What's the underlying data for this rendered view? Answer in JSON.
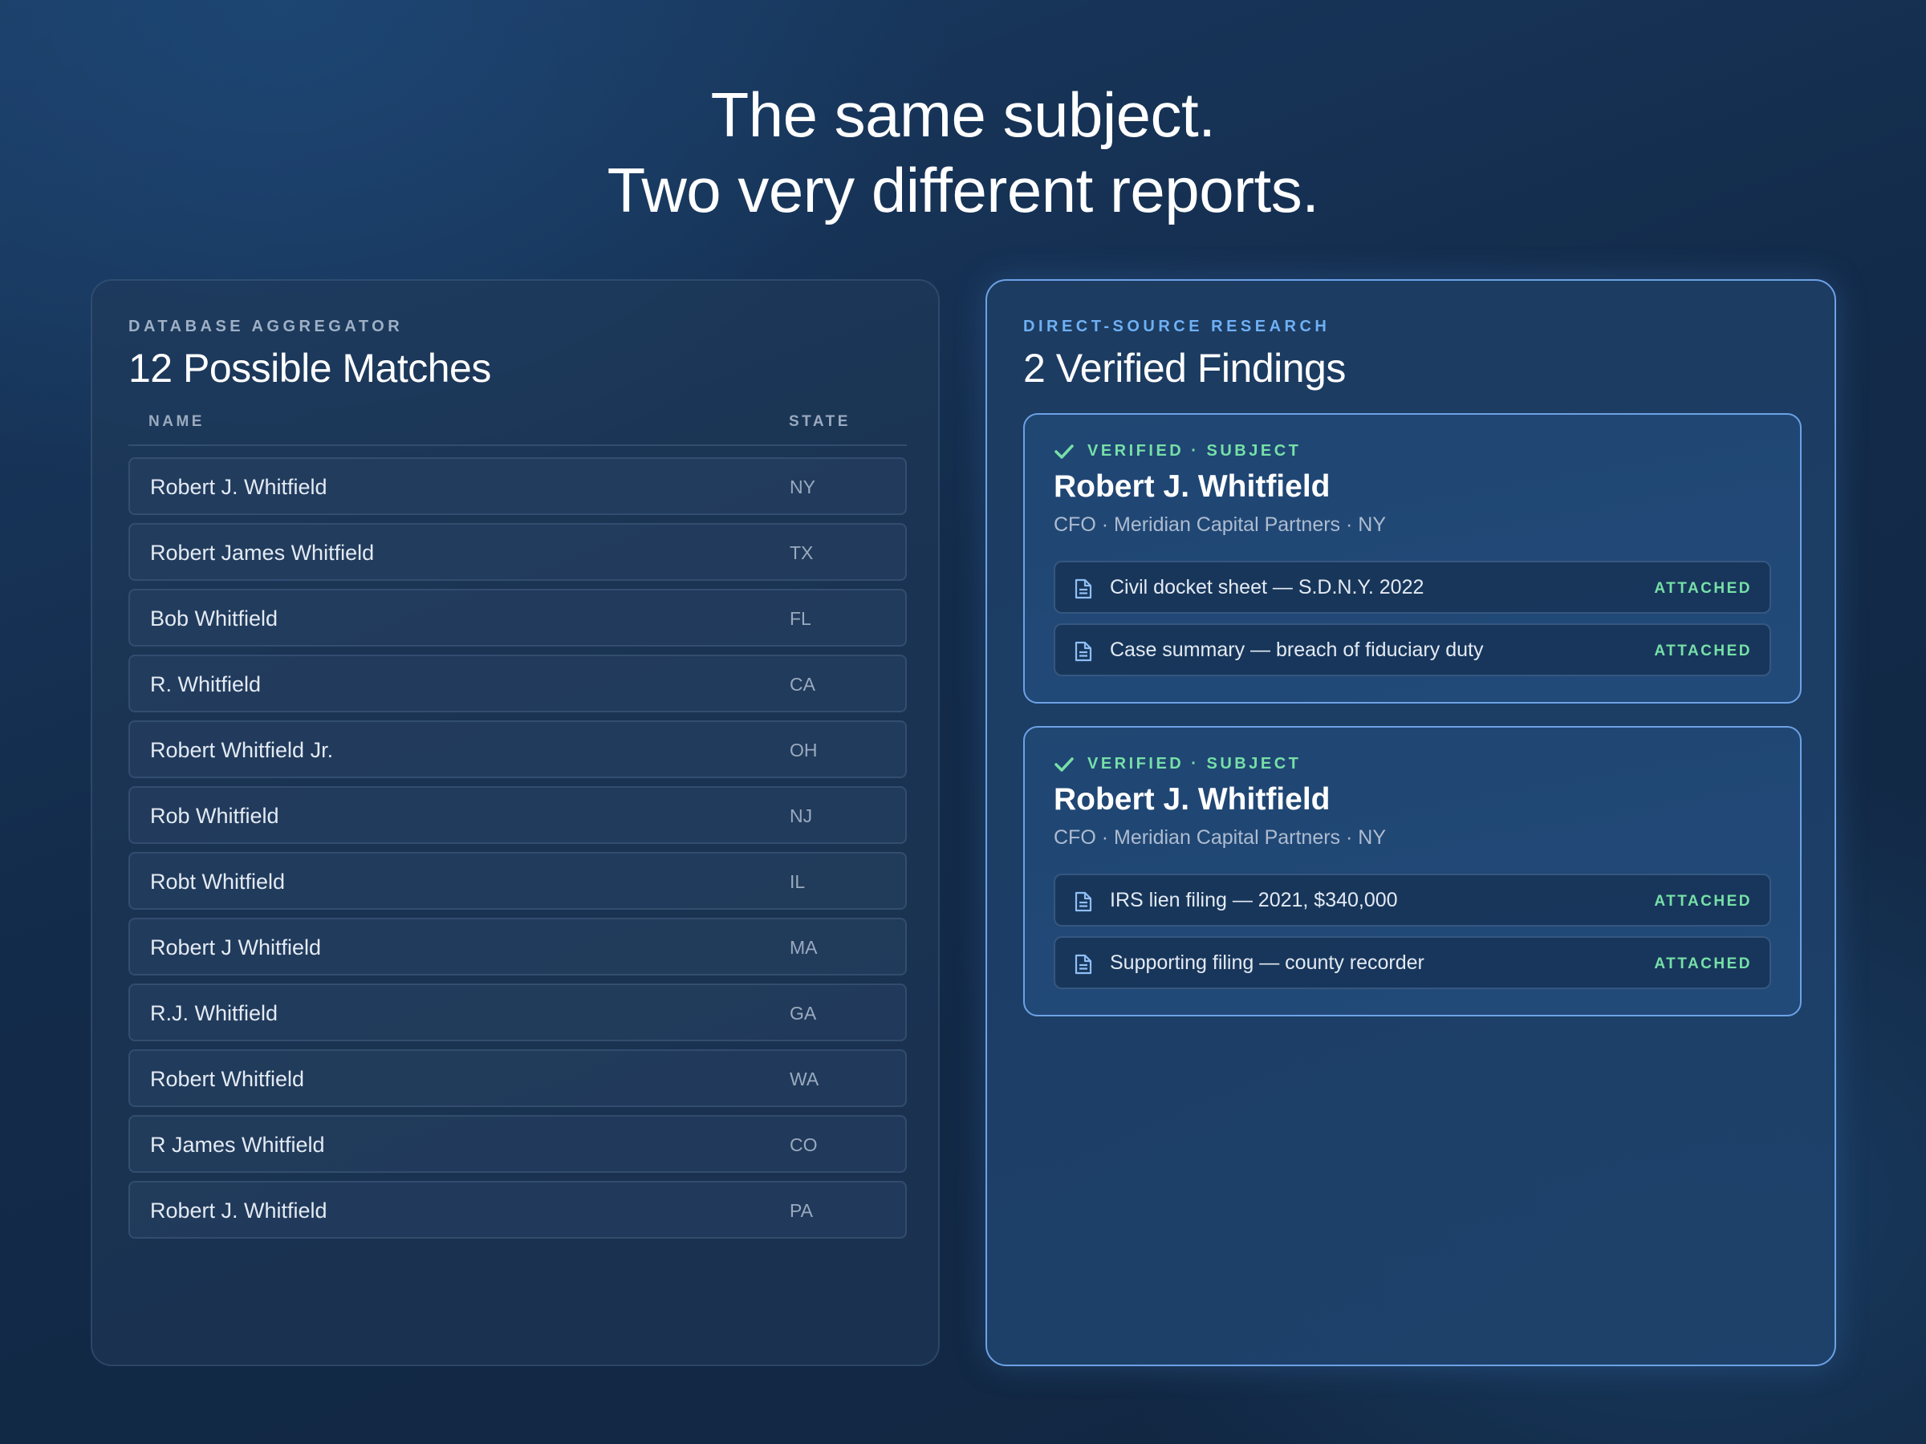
{
  "headline": {
    "line1": "The same subject.",
    "line2": "Two very different reports."
  },
  "left_panel": {
    "eyebrow": "DATABASE AGGREGATOR",
    "title": "12 Possible Matches",
    "columns": {
      "name": "NAME",
      "state": "STATE"
    },
    "rows": [
      {
        "name": "Robert J. Whitfield",
        "state": "NY"
      },
      {
        "name": "Robert James Whitfield",
        "state": "TX"
      },
      {
        "name": "Bob Whitfield",
        "state": "FL"
      },
      {
        "name": "R. Whitfield",
        "state": "CA"
      },
      {
        "name": "Robert Whitfield Jr.",
        "state": "OH"
      },
      {
        "name": "Rob Whitfield",
        "state": "NJ"
      },
      {
        "name": "Robt Whitfield",
        "state": "IL"
      },
      {
        "name": "Robert J Whitfield",
        "state": "MA"
      },
      {
        "name": "R.J. Whitfield",
        "state": "GA"
      },
      {
        "name": "Robert Whitfield",
        "state": "WA"
      },
      {
        "name": "R James Whitfield",
        "state": "CO"
      },
      {
        "name": "Robert J. Whitfield",
        "state": "PA"
      }
    ]
  },
  "right_panel": {
    "eyebrow": "DIRECT-SOURCE RESEARCH",
    "title": "2 Verified Findings",
    "findings": [
      {
        "badge": "VERIFIED · SUBJECT",
        "name": "Robert J. Whitfield",
        "meta": "CFO · Meridian Capital Partners · NY",
        "documents": [
          {
            "label": "Civil docket sheet — S.D.N.Y. 2022",
            "status": "ATTACHED"
          },
          {
            "label": "Case summary — breach of fiduciary duty",
            "status": "ATTACHED"
          }
        ]
      },
      {
        "badge": "VERIFIED · SUBJECT",
        "name": "Robert J. Whitfield",
        "meta": "CFO · Meridian Capital Partners · NY",
        "documents": [
          {
            "label": "IRS lien filing — 2021, $340,000",
            "status": "ATTACHED"
          },
          {
            "label": "Supporting filing — county recorder",
            "status": "ATTACHED"
          }
        ]
      }
    ]
  },
  "colors": {
    "accent_blue": "#6fb0f5",
    "verified_green": "#76e0a8",
    "panel_border_highlight": "#6da2e6"
  },
  "icons": {
    "check": "check-icon",
    "document": "document-icon"
  }
}
